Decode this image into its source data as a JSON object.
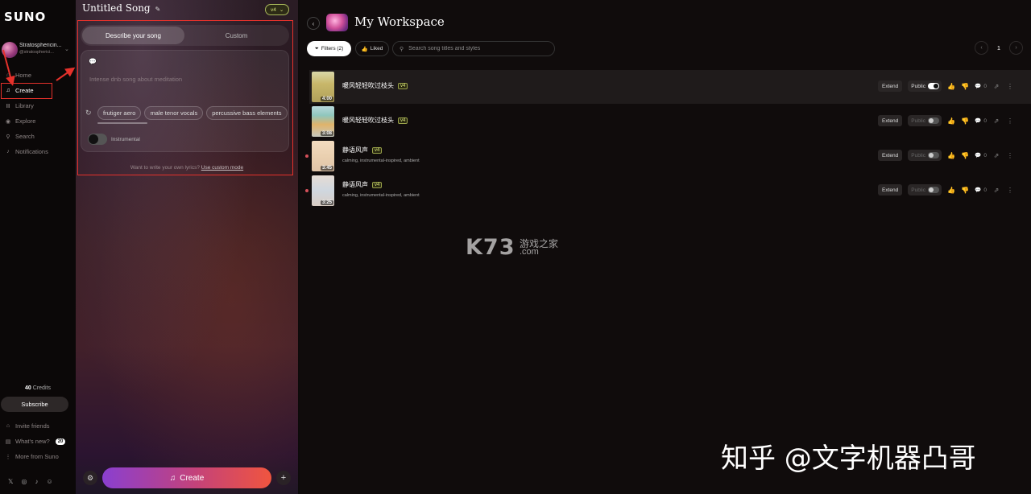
{
  "sidebar": {
    "logo": "SUNO",
    "profile": {
      "name": "Stratosphericin...",
      "handle": "@stratospherici..."
    },
    "nav": [
      {
        "label": "Home",
        "icon": "home-icon"
      },
      {
        "label": "Create",
        "icon": "music-note-icon"
      },
      {
        "label": "Library",
        "icon": "library-icon"
      },
      {
        "label": "Explore",
        "icon": "compass-icon"
      },
      {
        "label": "Search",
        "icon": "search-icon"
      },
      {
        "label": "Notifications",
        "icon": "bell-icon"
      }
    ],
    "credits_value": "40",
    "credits_label": "Credits",
    "subscribe_label": "Subscribe",
    "bottom_nav": [
      {
        "label": "Invite friends",
        "icon": "gift-icon"
      },
      {
        "label": "What's new?",
        "icon": "news-icon",
        "badge": "20"
      },
      {
        "label": "More from Suno",
        "icon": "more-icon"
      }
    ],
    "social": [
      "x-icon",
      "instagram-icon",
      "tiktok-icon",
      "discord-icon"
    ]
  },
  "create_panel": {
    "title": "Untitled Song",
    "version": "v4",
    "tabs": {
      "describe": "Describe your song",
      "custom": "Custom"
    },
    "description_placeholder": "Intense dnb song about meditation",
    "chips": [
      "frutiger aero",
      "male tenor vocals",
      "percussive bass elements"
    ],
    "instrumental_label": "Instrumental",
    "lyrics_hint": "Want to write your own lyrics?",
    "lyrics_link": "Use custom mode",
    "create_label": "Create"
  },
  "workspace": {
    "title": "My Workspace",
    "filters_label": "Filters (2)",
    "liked_label": "Liked",
    "search_placeholder": "Search song titles and styles",
    "page": "1",
    "songs": [
      {
        "title": "暖风轻轻吹过枝头",
        "version": "v4",
        "duration": "4:00",
        "styles": "",
        "public": true,
        "comments": "0"
      },
      {
        "title": "暖风轻轻吹过枝头",
        "version": "v4",
        "duration": "3:08",
        "styles": "",
        "public": false,
        "comments": "0"
      },
      {
        "title": "静语风声",
        "version": "v4",
        "duration": "3:45",
        "styles": "calming, instrumental-inspired, ambient",
        "public": false,
        "comments": "0"
      },
      {
        "title": "静语风声",
        "version": "v4",
        "duration": "3:25",
        "styles": "calming, instrumental-inspired, ambient",
        "public": false,
        "comments": "0"
      }
    ],
    "extend_label": "Extend",
    "public_label": "Public"
  },
  "watermarks": {
    "k73": "K73",
    "k73_cn": "游戏之家",
    "k73_com": ".com",
    "zhihu": "知乎 @文字机器凸哥"
  },
  "colors": {
    "accent_red": "#e5312b",
    "version_tag": "#d6e37a",
    "create_gradient_start": "#8a3fd0",
    "create_gradient_end": "#f0553f"
  }
}
